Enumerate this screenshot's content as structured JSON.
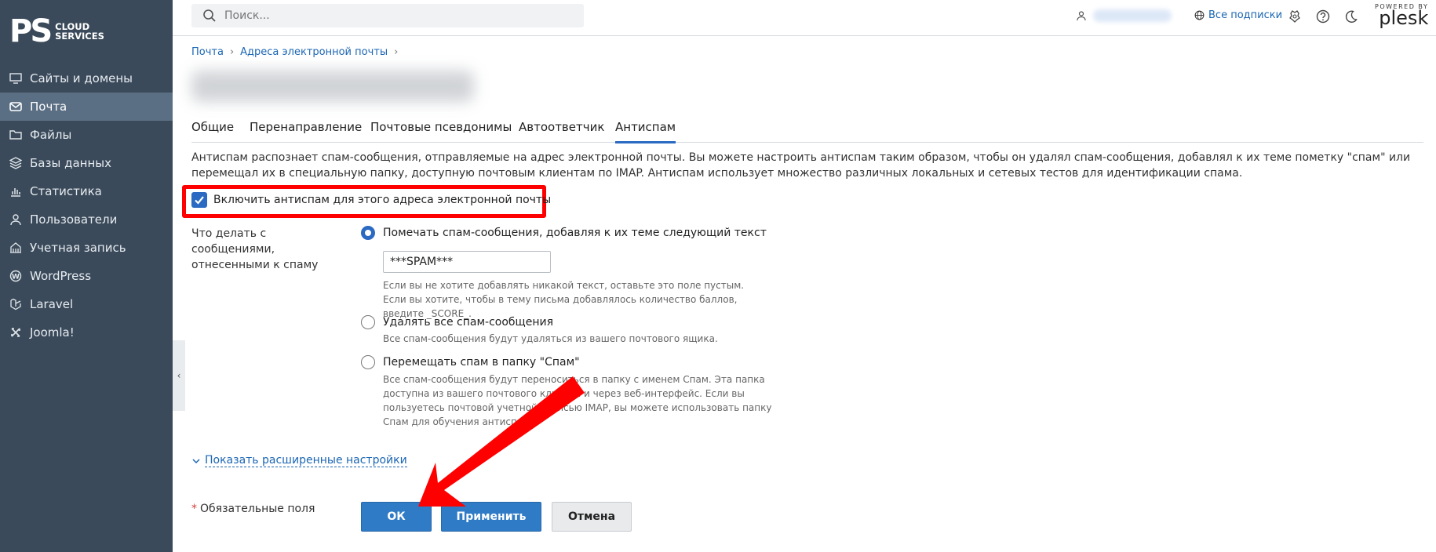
{
  "brand": {
    "logo_initials": "PS",
    "logo_line1": "CLOUD",
    "logo_line2": "SERVICES"
  },
  "sidebar": {
    "items": [
      {
        "label": "Сайты и домены",
        "icon": "monitor-icon",
        "active": false
      },
      {
        "label": "Почта",
        "icon": "mail-icon",
        "active": true
      },
      {
        "label": "Файлы",
        "icon": "folder-icon",
        "active": false
      },
      {
        "label": "Базы данных",
        "icon": "database-icon",
        "active": false
      },
      {
        "label": "Статистика",
        "icon": "bar-chart-icon",
        "active": false
      },
      {
        "label": "Пользователи",
        "icon": "user-icon",
        "active": false
      },
      {
        "label": "Учетная запись",
        "icon": "account-icon",
        "active": false
      },
      {
        "label": "WordPress",
        "icon": "wordpress-icon",
        "active": false
      },
      {
        "label": "Laravel",
        "icon": "laravel-icon",
        "active": false
      },
      {
        "label": "Joomla!",
        "icon": "joomla-icon",
        "active": false
      }
    ],
    "collapse_glyph": "‹"
  },
  "topbar": {
    "search_placeholder": "Поиск...",
    "subscriptions_label": "Все подписки",
    "powered_by": "POWERED BY",
    "plesk_label": "plesk"
  },
  "breadcrumb": [
    "Почта",
    "Адреса электронной почты"
  ],
  "tabs": [
    {
      "label": "Общие",
      "active": false
    },
    {
      "label": "Перенаправление",
      "active": false
    },
    {
      "label": "Почтовые псевдонимы",
      "active": false
    },
    {
      "label": "Автоответчик",
      "active": false
    },
    {
      "label": "Антиспам",
      "active": true
    }
  ],
  "antispam": {
    "description": "Антиспам распознает спам-сообщения, отправляемые на адрес электронной почты. Вы можете настроить антиспам таким образом, чтобы он удалял спам-сообщения, добавлял к их теме пометку \"спам\" или перемещал их в специальную папку, доступную почтовым клиентам по IMAP. Антиспам использует множество различных локальных и сетевых тестов для идентификации спама.",
    "enable_label": "Включить антиспам для этого адреса электронной почты",
    "enable_checked": true,
    "action_label": "Что делать с сообщениями, отнесенными к спаму",
    "options": [
      {
        "label": "Помечать спам-сообщения, добавляя к их теме следующий текст",
        "selected": true,
        "hint": "Если вы не хотите добавлять никакой текст, оставьте это поле пустым. Если вы хотите, чтобы в тему письма добавлялось количество баллов, введите _SCORE_."
      },
      {
        "label": "Удалять все спам-сообщения",
        "selected": false,
        "hint": "Все спам-сообщения будут удаляться из вашего почтового ящика."
      },
      {
        "label": "Перемещать спам в папку \"Спам\"",
        "selected": false,
        "hint": "Все спам-сообщения будут переноситься в папку с именем Спам. Эта папка доступна из вашего почтового клиента и через веб-интерфейс. Если вы пользуетесь почтовой учетной записью IMAP, вы можете использовать папку Спам для обучения антиспама."
      }
    ],
    "tag_value": "***SPAM***",
    "advanced_link": "Показать расширенные настройки"
  },
  "footer": {
    "required_star": "*",
    "required_label": "Обязательные поля",
    "ok_label": "ОК",
    "apply_label": "Применить",
    "cancel_label": "Отмена"
  },
  "colors": {
    "sidebar_bg": "#3b4a5a",
    "sidebar_active": "#5b6f84",
    "accent": "#2a6ac2",
    "link": "#1b66b4",
    "highlight": "#ff0000"
  }
}
